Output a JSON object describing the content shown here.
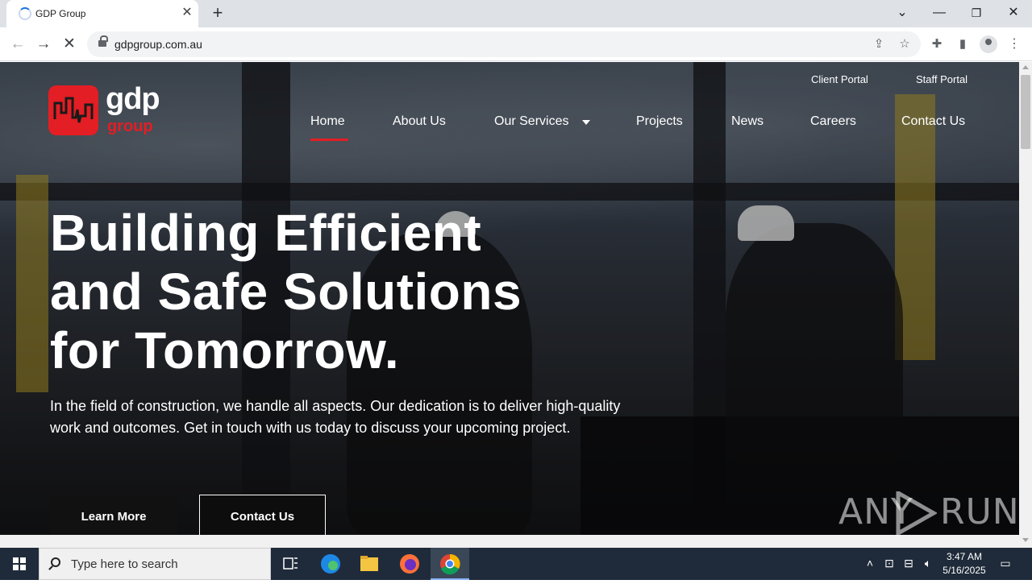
{
  "browser": {
    "tab_title": "GDP Group",
    "url": "gdpgroup.com.au"
  },
  "site": {
    "logo": {
      "wordmark": "gdp",
      "sub": "group",
      "brand_color": "#e31e24"
    },
    "utility_links": [
      "Client Portal",
      "Staff Portal"
    ],
    "nav": {
      "home": "Home",
      "about": "About Us",
      "services": "Our Services",
      "projects": "Projects",
      "news": "News",
      "careers": "Careers",
      "contact": "Contact Us"
    },
    "hero": {
      "title_lines": [
        "Building Efficient",
        "and Safe Solutions",
        "for Tomorrow."
      ],
      "text": "In the field of construction, we handle all aspects. Our dedication is to deliver high-quality work and outcomes. Get in touch with us today to discuss your upcoming project.",
      "learn_more": "Learn More",
      "contact": "Contact Us"
    },
    "watermark": {
      "left": "ANY",
      "right": "RUN"
    }
  },
  "taskbar": {
    "search_placeholder": "Type here to search",
    "time": "3:47 AM",
    "date": "5/16/2025"
  }
}
